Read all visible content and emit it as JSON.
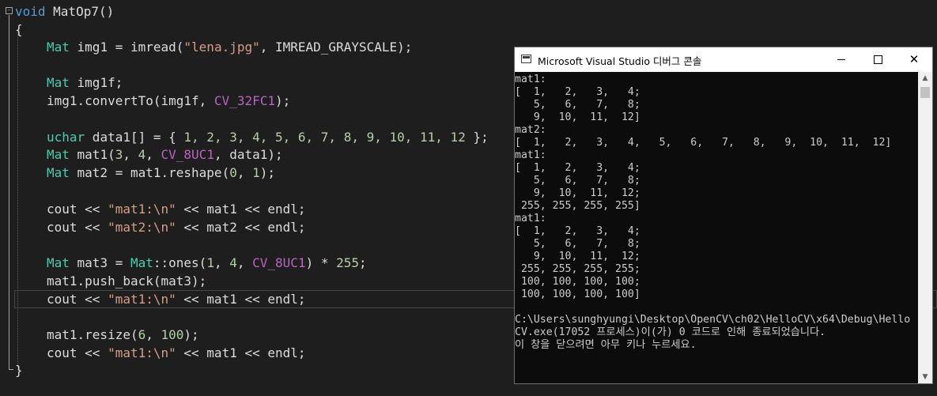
{
  "editor": {
    "fold_marker": "-",
    "code": {
      "func": {
        "kw": "void",
        "name": " MatOp7()"
      },
      "open_brace": "{",
      "l1": {
        "type": "Mat",
        "a": " img1 = imread(",
        "str": "\"lena.jpg\"",
        "b": ", IMREAD_GRAYSCALE);"
      },
      "l2": {
        "type": "Mat",
        "a": " img1f;"
      },
      "l3": {
        "a": "img1.convertTo(img1f, ",
        "macro": "CV_32FC1",
        "b": ");"
      },
      "l4": {
        "type": "uchar",
        "a": " data1[] = { ",
        "nums": "1, 2, 3, 4, 5, 6, 7, 8, 9, 10, 11, 12",
        "b": " };"
      },
      "l5": {
        "type": "Mat",
        "a": " mat1(",
        "n1": "3",
        "c1": ", ",
        "n2": "4",
        "c2": ", ",
        "macro": "CV_8UC1",
        "b": ", data1);"
      },
      "l6": {
        "type": "Mat",
        "a": " mat2 = mat1.reshape(",
        "n1": "0",
        "c1": ", ",
        "n2": "1",
        "b": ");"
      },
      "l7": {
        "a": "cout << ",
        "str": "\"mat1:\\n\"",
        "b": " << mat1 << endl;"
      },
      "l8": {
        "a": "cout << ",
        "str": "\"mat2:\\n\"",
        "b": " << mat2 << endl;"
      },
      "l9": {
        "type": "Mat",
        "a": " mat3 = ",
        "type2": "Mat",
        "b": "::ones(",
        "n1": "1",
        "c1": ", ",
        "n2": "4",
        "c2": ", ",
        "macro": "CV_8UC1",
        "c": ") * ",
        "n3": "255",
        "d": ";"
      },
      "l10": {
        "a": "mat1.push_back(mat3);"
      },
      "l11": {
        "a": "cout << ",
        "str": "\"mat1:\\n\"",
        "b": " << mat1 << endl;"
      },
      "l12": {
        "a": "mat1.resize(",
        "n1": "6",
        "c1": ", ",
        "n2": "100",
        "b": ");"
      },
      "l13": {
        "a": "cout << ",
        "str": "\"mat1:\\n\"",
        "b": " << mat1 << endl;"
      },
      "close_brace": "}"
    }
  },
  "console": {
    "title": "Microsoft Visual Studio 디버그 콘솔",
    "buttons": {
      "minimize": "",
      "maximize": "",
      "close": "✕"
    },
    "scroll_up": "▲",
    "scroll_down": "▼",
    "output_lines": [
      "mat1:",
      "[  1,   2,   3,   4;",
      "   5,   6,   7,   8;",
      "   9,  10,  11,  12]",
      "mat2:",
      "[  1,   2,   3,   4,   5,   6,   7,   8,   9,  10,  11,  12]",
      "mat1:",
      "[  1,   2,   3,   4;",
      "   5,   6,   7,   8;",
      "   9,  10,  11,  12;",
      " 255, 255, 255, 255]",
      "mat1:",
      "[  1,   2,   3,   4;",
      "   5,   6,   7,   8;",
      "   9,  10,  11,  12;",
      " 255, 255, 255, 255;",
      " 100, 100, 100, 100;",
      " 100, 100, 100, 100]",
      "",
      "C:\\Users\\sunghyungi\\Desktop\\OpenCV\\ch02\\HelloCV\\x64\\Debug\\Hello",
      "CV.exe(17052 프로세스)이(가) 0 코드로 인해 종료되었습니다.",
      "이 창을 닫으려면 아무 키나 누르세요."
    ]
  }
}
